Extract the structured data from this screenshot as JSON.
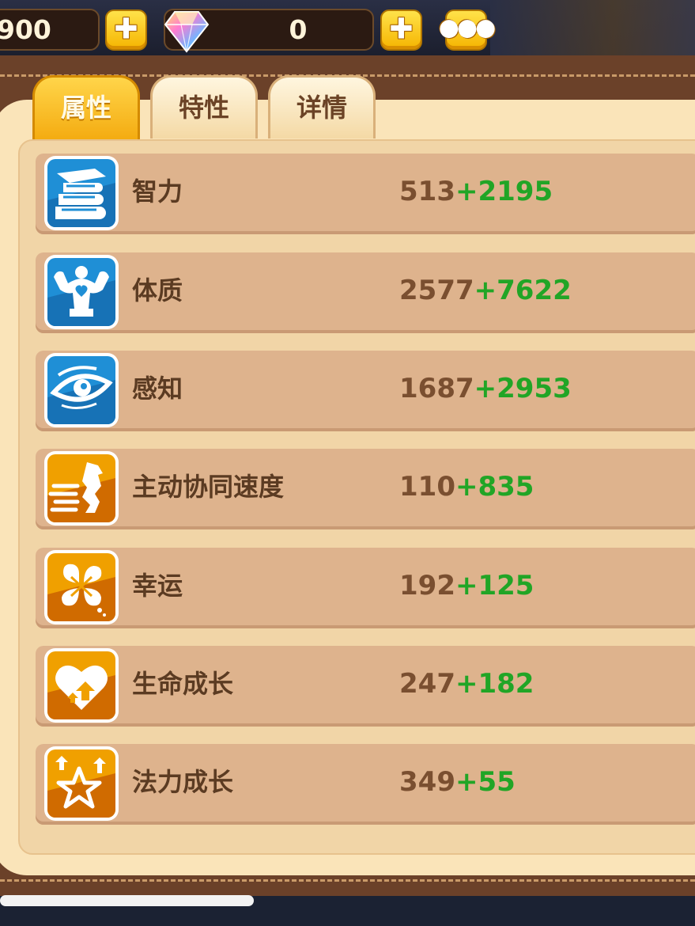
{
  "topbar": {
    "gold_amount": "900",
    "gem_amount": "0"
  },
  "tabs": [
    "属性",
    "特性",
    "详情"
  ],
  "stats": [
    {
      "label": "智力",
      "base": "513",
      "bonus": "+2195",
      "icon": "books-icon"
    },
    {
      "label": "体质",
      "base": "2577",
      "bonus": "+7622",
      "icon": "muscle-icon"
    },
    {
      "label": "感知",
      "base": "1687",
      "bonus": "+2953",
      "icon": "eye-icon"
    },
    {
      "label": "主动协同速度",
      "base": "110",
      "bonus": "+835",
      "icon": "speed-icon"
    },
    {
      "label": "幸运",
      "base": "192",
      "bonus": "+125",
      "icon": "clover-icon"
    },
    {
      "label": "生命成长",
      "base": "247",
      "bonus": "+182",
      "icon": "heart-up-icon"
    },
    {
      "label": "法力成长",
      "base": "349",
      "bonus": "+55",
      "icon": "star-up-icon"
    }
  ],
  "colors": {
    "base_value": "#7a4f30",
    "bonus_value": "#21a526",
    "label": "#5b3b22",
    "row_bg": "#deb38d",
    "blue_tile": "#1f8fd6",
    "orange_tile": "#f0a000"
  }
}
